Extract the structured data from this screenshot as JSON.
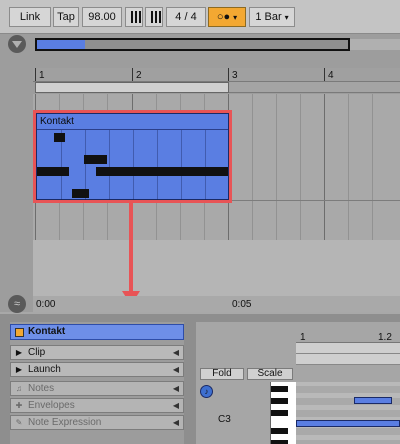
{
  "transport": {
    "link_label": "Link",
    "tap_label": "Tap",
    "tempo": "98.00",
    "meter": "4 / 4",
    "quantize": "1 Bar",
    "record_glyph": "○●",
    "caret": "▾"
  },
  "arrangement": {
    "bar_numbers": [
      "1",
      "2",
      "3",
      "4"
    ],
    "clip_name": "Kontakt",
    "time_labels": [
      "0:00",
      "0:05"
    ]
  },
  "clip_panel": {
    "header_label": "Kontakt",
    "sections": [
      {
        "label": "Clip",
        "icon": "clip-icon",
        "enabled": true
      },
      {
        "label": "Launch",
        "icon": "launch-icon",
        "enabled": true
      },
      {
        "label": "Notes",
        "icon": "notes-icon",
        "enabled": false
      },
      {
        "label": "Envelopes",
        "icon": "envelopes-icon",
        "enabled": false
      },
      {
        "label": "Note Expression",
        "icon": "note-expression-icon",
        "enabled": false
      }
    ],
    "arrow_glyph": "◀"
  },
  "piano_roll": {
    "ruler_labels": [
      "1",
      "1.2"
    ],
    "fold_label": "Fold",
    "scale_label": "Scale",
    "key_label": "C3"
  },
  "colors": {
    "clip": "#5a7ee2",
    "highlight": "#e85456",
    "accent": "#f3a832"
  }
}
